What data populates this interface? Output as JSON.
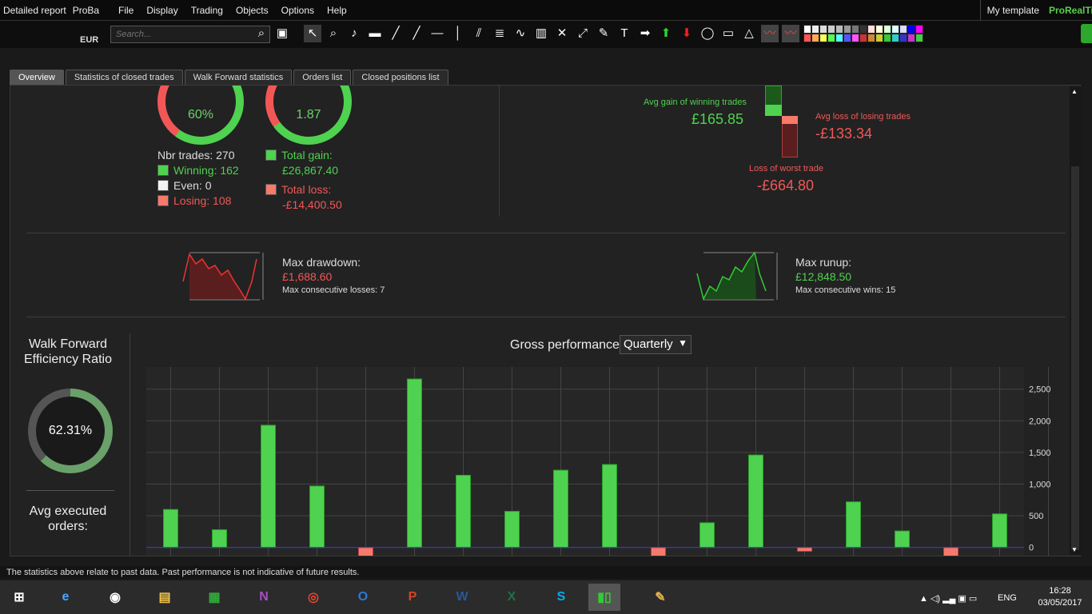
{
  "window": {
    "title_left": "Detailed report",
    "title_mid": "ProBa",
    "template_label": "My template",
    "brand": "ProRealTi"
  },
  "menu": [
    "File",
    "Display",
    "Trading",
    "Objects",
    "Options",
    "Help"
  ],
  "search": {
    "placeholder": "Search..."
  },
  "instrument": "EUR",
  "tabs": [
    "Overview",
    "Statistics of closed trades",
    "Walk Forward statistics",
    "Orders list",
    "Closed positions list"
  ],
  "overview": {
    "winning_pct": "60%",
    "gain_loss_ratio": "1.87",
    "nbr_trades": "Nbr trades: 270",
    "winning": "Winning: 162",
    "even": "Even: 0",
    "losing": "Losing: 108",
    "total_gain_label": "Total gain:",
    "total_gain": "£26,867.40",
    "total_loss_label": "Total loss:",
    "total_loss": "-£14,400.50",
    "avg_gain_label": "Avg gain of winning trades",
    "avg_gain": "£165.85",
    "avg_loss_label": "Avg loss of losing trades",
    "avg_loss": "-£133.34",
    "worst_label": "Loss of worst trade",
    "worst": "-£664.80",
    "max_dd_label": "Max drawdown:",
    "max_dd": "£1,688.60",
    "max_losses": "Max consecutive losses: 7",
    "max_ru_label": "Max runup:",
    "max_ru": "£12,848.50",
    "max_wins": "Max consecutive wins: 15",
    "wfe_label": "Walk Forward Efficiency Ratio",
    "wfe": "62.31%",
    "wfe_fraction": 0.6231,
    "avg_orders_label": "Avg executed orders:"
  },
  "gross": {
    "title": "Gross performance",
    "period": "Quarterly"
  },
  "colors": {
    "green": "#4fd24f",
    "red": "#f25757",
    "bg": "#222222"
  },
  "chart_data": {
    "type": "bar",
    "title": "Gross performance",
    "y_ticks": [
      "0",
      "500",
      "1,000",
      "1,500",
      "2,000",
      "2,500"
    ],
    "ylim": [
      -180,
      2850
    ],
    "values": [
      600,
      280,
      1930,
      970,
      -180,
      2660,
      1140,
      570,
      1220,
      1310,
      -180,
      390,
      1460,
      -60,
      720,
      260,
      -180,
      530
    ],
    "grid": true
  },
  "status": "The statistics above relate to past data. Past performance is not indicative of future results.",
  "clock": {
    "time": "16:28",
    "date": "03/05/2017",
    "lang": "ENG"
  }
}
